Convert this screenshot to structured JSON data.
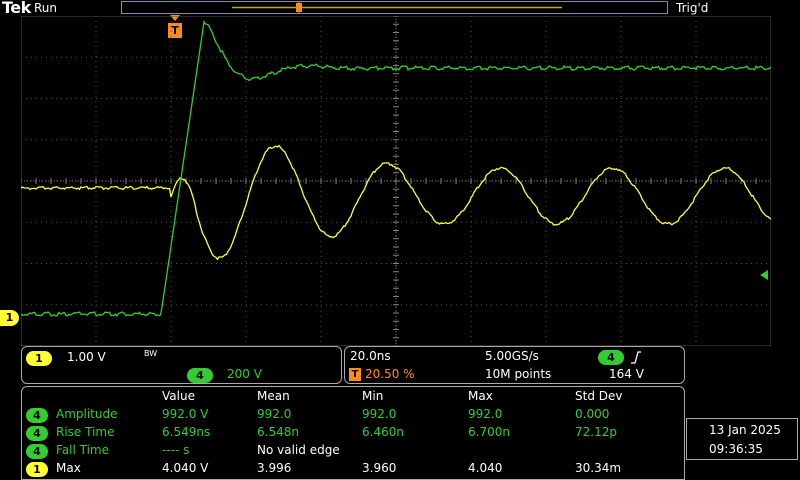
{
  "header": {
    "logo": "Tek",
    "run_status": "Run",
    "trigger_status": "Trig'd"
  },
  "markers": {
    "ch1_label": "1",
    "trigger_t": "T"
  },
  "colors": {
    "ch1": "#ffff33",
    "ch4": "#33cc33",
    "trigger": "#ff8c1a",
    "grid": "#505050"
  },
  "vertical_panel": {
    "ch1_badge": "1",
    "ch1_scale": "1.00 V",
    "bw_label": "BW",
    "ch4_badge": "4",
    "ch4_scale": "200 V"
  },
  "horizontal_panel": {
    "time_scale": "20.0ns",
    "sample_rate": "5.00GS/s",
    "trig_badge": "T",
    "trigger_position": "20.50 %",
    "record_length": "10M points",
    "trigger_source_badge": "4",
    "trigger_slope_icon": "rising-edge",
    "trigger_level": "164 V"
  },
  "measurements": {
    "headers": [
      "Value",
      "Mean",
      "Min",
      "Max",
      "Std Dev"
    ],
    "rows": [
      {
        "channel": "4",
        "name": "Amplitude",
        "value": "992.0 V",
        "mean": "992.0",
        "min": "992.0",
        "max": "992.0",
        "std": "0.000"
      },
      {
        "channel": "4",
        "name": "Rise Time",
        "value": "6.549ns",
        "mean": "6.548n",
        "min": "6.460n",
        "max": "6.700n",
        "std": "72.12p"
      },
      {
        "channel": "4",
        "name": "Fall Time",
        "value": "---- s",
        "mean": "No valid edge",
        "min": "",
        "max": "",
        "std": ""
      },
      {
        "channel": "1",
        "name": "Max",
        "value": "4.040 V",
        "mean": "3.996",
        "min": "3.960",
        "max": "4.040",
        "std": "30.34m"
      }
    ]
  },
  "datetime": {
    "date": "13 Jan  2025",
    "time": "09:36:35"
  }
}
